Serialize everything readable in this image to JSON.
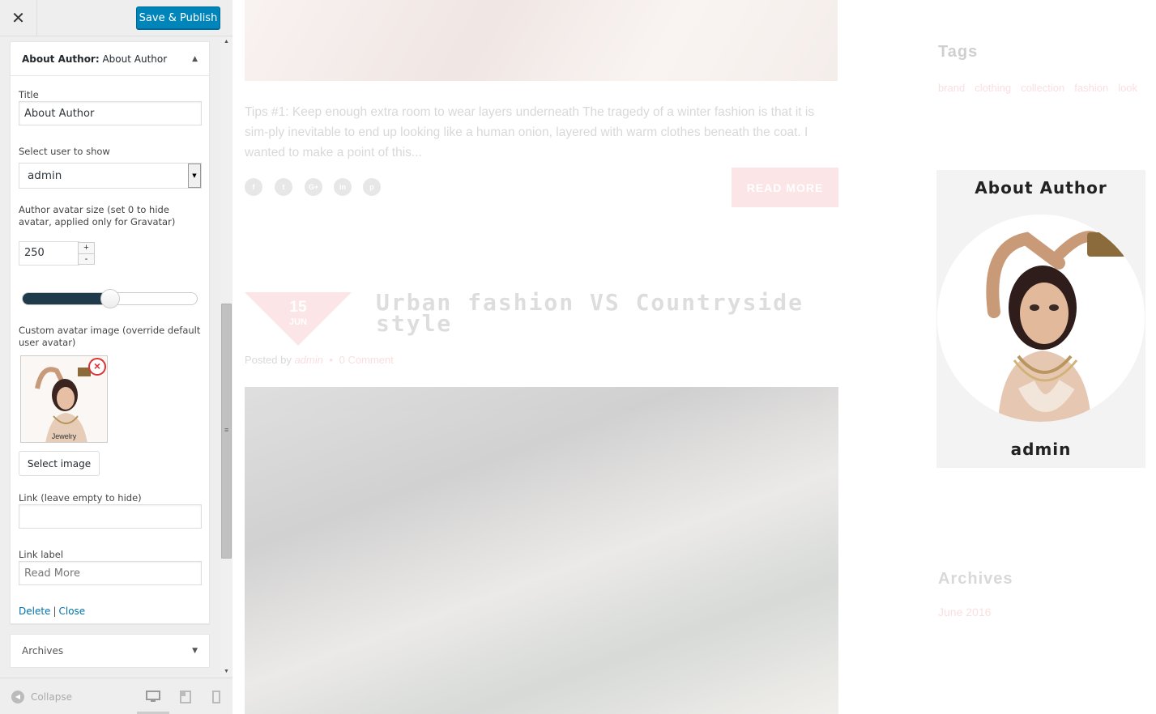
{
  "customizer": {
    "close_icon": "close-icon",
    "publish_label": "Save & Publish",
    "widget": {
      "title_bold": "About Author:",
      "title_rest": " About Author",
      "fields": {
        "title_label": "Title",
        "title_value": "About Author",
        "user_label": "Select user to show",
        "user_value": "admin",
        "size_label": "Author avatar size (set 0 to hide avatar, applied only for Gravatar)",
        "size_value": "250",
        "size_plus": "+",
        "size_minus": "-",
        "size_slider_fraction": 0.5,
        "custom_avatar_label": "Custom avatar image (override default user avatar)",
        "avatar_caption": "Jewelry",
        "select_image_label": "Select image",
        "link_label": "Link (leave empty to hide)",
        "link_value": "",
        "link_label_label": "Link label",
        "link_label_placeholder": "Read More"
      },
      "delete_label": "Delete",
      "separator": "|",
      "close_label": "Close"
    },
    "archives_widget_label": "Archives",
    "footer": {
      "collapse_label": "Collapse",
      "devices": [
        "desktop-icon",
        "tablet-icon",
        "mobile-icon"
      ]
    }
  },
  "preview": {
    "excerpt": "Tips #1: Keep enough extra room to wear layers underneath The tragedy of a winter fashion is that it is sim-ply inevitable to end up looking like a human onion, layered with warm clothes beneath the coat. I wanted to make a point of this...",
    "read_more": "READ MORE",
    "social_icons": [
      "f",
      "t",
      "G+",
      "in",
      "p"
    ],
    "post": {
      "day": "15",
      "month": "JUN",
      "title": "Urban fashion VS Countryside style",
      "posted_by": "Posted by ",
      "author": "admin",
      "bullet": "•",
      "comments": "0 Comment"
    },
    "sidebar": {
      "tags_title": "Tags",
      "tags": [
        "brand",
        "clothing",
        "collection",
        "fashion",
        "look"
      ],
      "about_title": "About Author",
      "about_name": "admin",
      "archives_title": "Archives",
      "archives_item": "June 2016"
    }
  },
  "colors": {
    "publish_blue": "#0085ba",
    "link_blue": "#0073aa",
    "accent_pink": "#f5a3a8"
  }
}
